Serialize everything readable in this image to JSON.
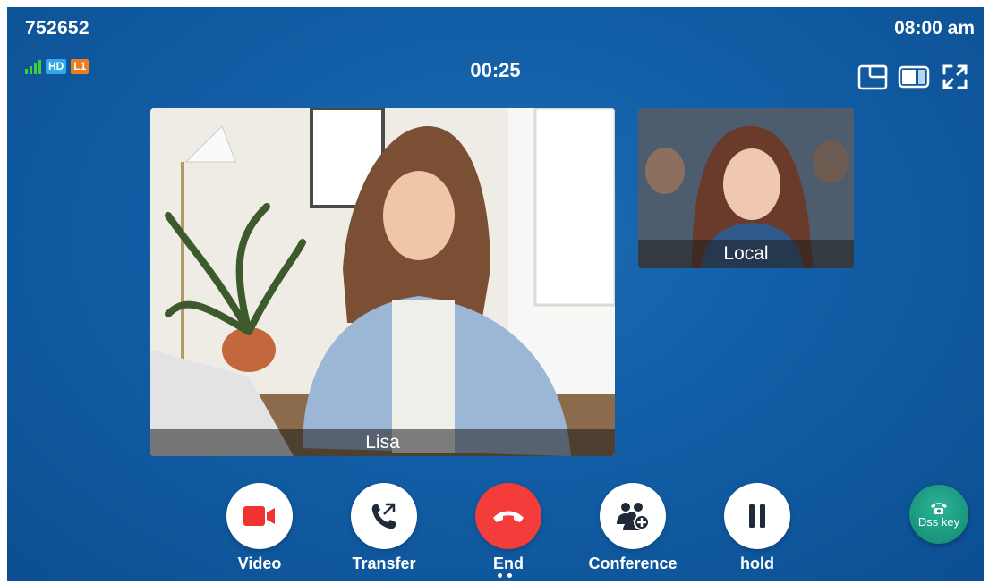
{
  "header": {
    "extension": "752652",
    "time": "08:00 am",
    "hd_badge": "HD",
    "line_badge": "L1",
    "call_timer": "00:25"
  },
  "layout_icons": [
    "picture-in-picture-icon",
    "split-view-icon",
    "fullscreen-icon"
  ],
  "videos": {
    "remote_name": "Lisa",
    "local_name": "Local"
  },
  "controls": [
    {
      "label": "Video",
      "icon": "video-camera-icon"
    },
    {
      "label": "Transfer",
      "icon": "transfer-phone-icon"
    },
    {
      "label": "End",
      "icon": "end-call-icon"
    },
    {
      "label": "Conference",
      "icon": "conference-add-icon"
    },
    {
      "label": "hold",
      "icon": "pause-icon"
    }
  ],
  "dss_key": {
    "label": "Dss key",
    "icon": "phone-icon"
  },
  "colors": {
    "background": "#1263a9",
    "end_red": "#f43d3a",
    "video_red": "#f0332f",
    "signal_green": "#3fce3a",
    "hd_blue": "#31a8e8",
    "line_orange": "#f07c1e",
    "dss_teal": "#1fa386"
  }
}
